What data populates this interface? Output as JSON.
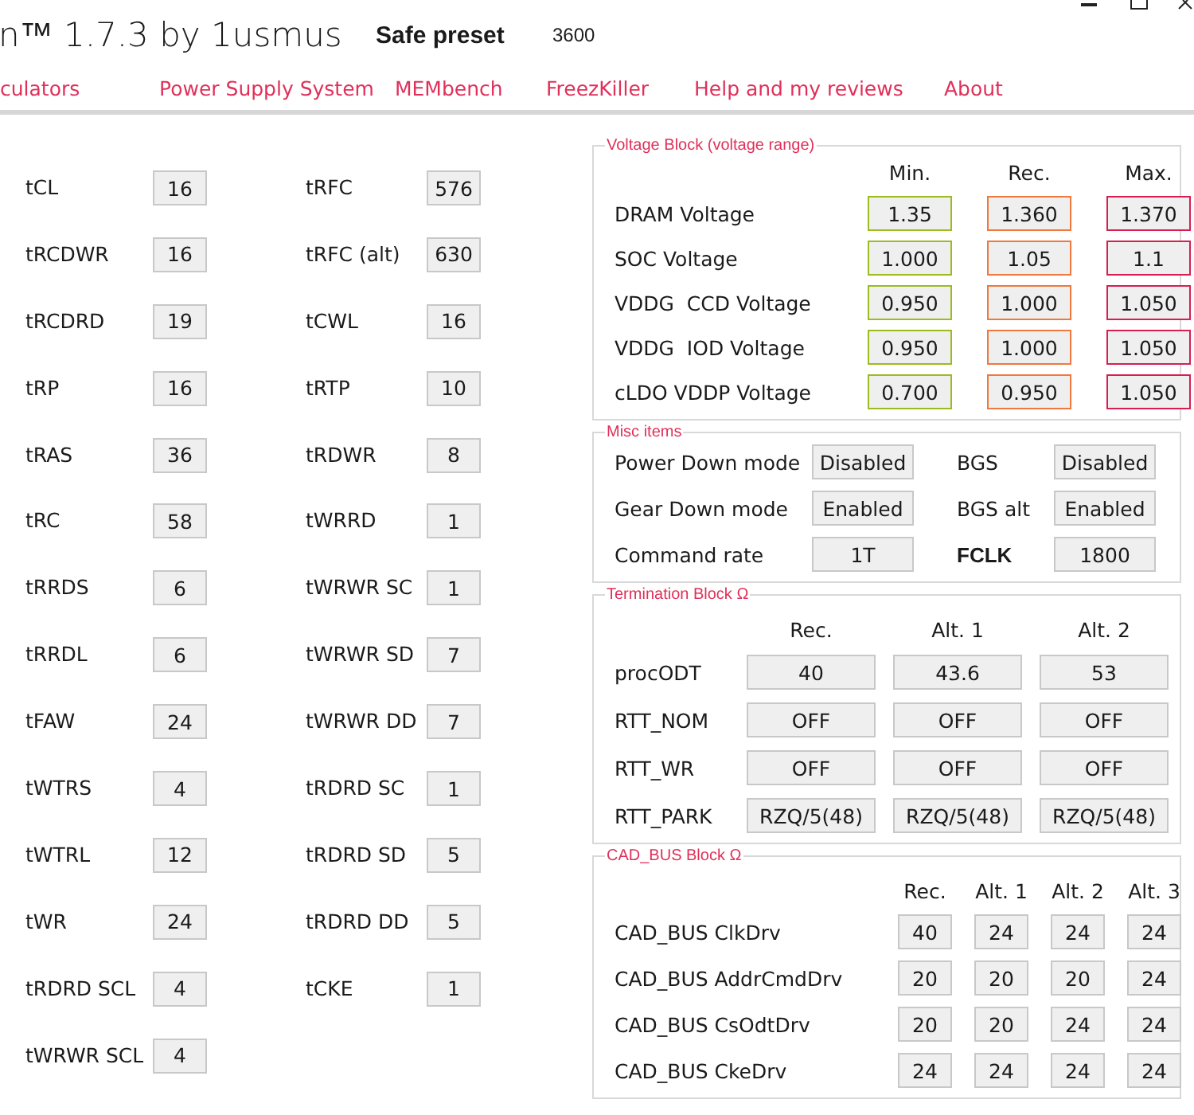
{
  "window": {
    "title": "n™ 1.7.3 by 1usmus",
    "preset": "Safe preset",
    "frequency": "3600"
  },
  "nav": [
    "culators",
    "Power Supply System",
    "MEMbench",
    "FreezKiller",
    "Help and my reviews",
    "About"
  ],
  "timings": {
    "column_1": [
      {
        "label": "tCL",
        "value": "16"
      },
      {
        "label": "tRCDWR",
        "value": "16"
      },
      {
        "label": "tRCDRD",
        "value": "19"
      },
      {
        "label": "tRP",
        "value": "16"
      },
      {
        "label": "tRAS",
        "value": "36"
      },
      {
        "label": "tRC",
        "value": "58"
      },
      {
        "label": "tRRDS",
        "value": "6"
      },
      {
        "label": "tRRDL",
        "value": "6"
      },
      {
        "label": "tFAW",
        "value": "24"
      },
      {
        "label": "tWTRS",
        "value": "4"
      },
      {
        "label": "tWTRL",
        "value": "12"
      },
      {
        "label": "tWR",
        "value": "24"
      },
      {
        "label": "tRDRD SCL",
        "value": "4"
      },
      {
        "label": "tWRWR SCL",
        "value": "4"
      }
    ],
    "column_2": [
      {
        "label": "tRFC",
        "value": "576"
      },
      {
        "label": "tRFC (alt)",
        "value": "630"
      },
      {
        "label": "tCWL",
        "value": "16"
      },
      {
        "label": "tRTP",
        "value": "10"
      },
      {
        "label": "tRDWR",
        "value": "8"
      },
      {
        "label": "tWRRD",
        "value": "1"
      },
      {
        "label": "tWRWR SC",
        "value": "1"
      },
      {
        "label": "tWRWR SD",
        "value": "7"
      },
      {
        "label": "tWRWR DD",
        "value": "7"
      },
      {
        "label": "tRDRD SC",
        "value": "1"
      },
      {
        "label": "tRDRD SD",
        "value": "5"
      },
      {
        "label": "tRDRD DD",
        "value": "5"
      },
      {
        "label": "tCKE",
        "value": "1"
      }
    ]
  },
  "voltage_block": {
    "title": "Voltage Block (voltage range)",
    "columns": [
      {
        "label": "Min.",
        "color": "#9bbb1e"
      },
      {
        "label": "Rec.",
        "color": "#f0783c"
      },
      {
        "label": "Max.",
        "color": "#d81e50"
      }
    ],
    "rows": [
      {
        "label": "DRAM Voltage",
        "values": [
          "1.35",
          "1.360",
          "1.370"
        ]
      },
      {
        "label": "SOC Voltage",
        "values": [
          "1.000",
          "1.05",
          "1.1"
        ]
      },
      {
        "label": "VDDG  CCD Voltage",
        "values": [
          "0.950",
          "1.000",
          "1.050"
        ]
      },
      {
        "label": "VDDG  IOD Voltage",
        "values": [
          "0.950",
          "1.000",
          "1.050"
        ]
      },
      {
        "label": "cLDO VDDP Voltage",
        "values": [
          "0.700",
          "0.950",
          "1.050"
        ]
      }
    ]
  },
  "misc_items": {
    "title": "Misc items",
    "rows": [
      [
        {
          "label": "Power Down mode",
          "value": "Disabled",
          "emphasis": false
        },
        {
          "label": "BGS",
          "value": "Disabled",
          "emphasis": false
        }
      ],
      [
        {
          "label": "Gear Down mode",
          "value": "Enabled",
          "emphasis": false
        },
        {
          "label": "BGS alt",
          "value": "Enabled",
          "emphasis": false
        }
      ],
      [
        {
          "label": "Command rate",
          "value": "1T",
          "emphasis": false
        },
        {
          "label": "FCLK",
          "value": "1800",
          "emphasis": true
        }
      ]
    ]
  },
  "termination_block": {
    "title": "Termination Block Ω",
    "columns": [
      "Rec.",
      "Alt. 1",
      "Alt. 2"
    ],
    "rows": [
      {
        "label": "procODT",
        "values": [
          "40",
          "43.6",
          "53"
        ]
      },
      {
        "label": "RTT_NOM",
        "values": [
          "OFF",
          "OFF",
          "OFF"
        ]
      },
      {
        "label": "RTT_WR",
        "values": [
          "OFF",
          "OFF",
          "OFF"
        ]
      },
      {
        "label": "RTT_PARK",
        "values": [
          "RZQ/5(48)",
          "RZQ/5(48)",
          "RZQ/5(48)"
        ]
      }
    ]
  },
  "cad_bus_block": {
    "title": "CAD_BUS Block Ω",
    "columns": [
      "Rec.",
      "Alt. 1",
      "Alt. 2",
      "Alt. 3"
    ],
    "rows": [
      {
        "label": "CAD_BUS ClkDrv",
        "values": [
          "40",
          "24",
          "24",
          "24"
        ]
      },
      {
        "label": "CAD_BUS AddrCmdDrv",
        "values": [
          "20",
          "20",
          "20",
          "24"
        ]
      },
      {
        "label": "CAD_BUS CsOdtDrv",
        "values": [
          "20",
          "20",
          "24",
          "24"
        ]
      },
      {
        "label": "CAD_BUS CkeDrv",
        "values": [
          "24",
          "24",
          "24",
          "24"
        ]
      }
    ]
  }
}
